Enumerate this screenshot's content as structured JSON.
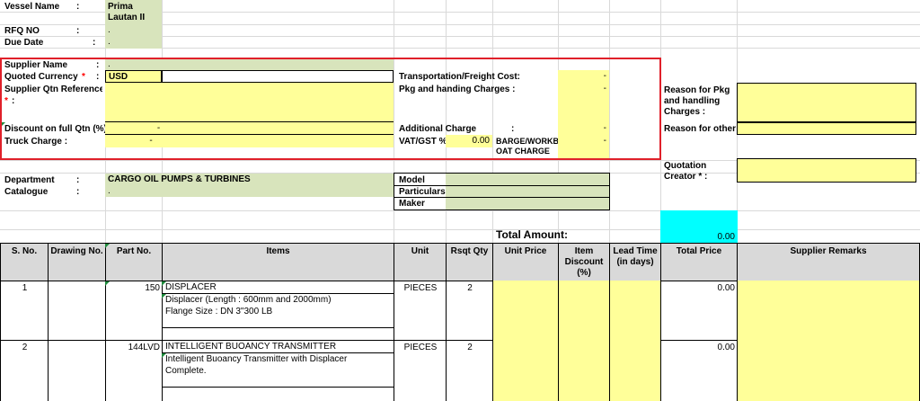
{
  "header": {
    "vessel_name_label": "Vessel Name",
    "vessel_name_colon": ":",
    "vessel_name_value_1": "Prima",
    "vessel_name_value_2": "Lautan II",
    "rfq_no_label": "RFQ NO",
    "rfq_no_colon": ":",
    "rfq_no_value": ".",
    "due_date_label": "Due Date",
    "due_date_colon": ":",
    "due_date_value": "."
  },
  "supplier": {
    "supplier_name_label": "Supplier Name",
    "supplier_name_colon": ":",
    "supplier_name_value": ".",
    "quoted_currency_label": "Quoted Currency",
    "quoted_currency_star": "*",
    "quoted_currency_colon": ":",
    "quoted_currency_value": "USD",
    "supplier_qtn_ref_label": "Supplier Qtn Reference",
    "supplier_qtn_ref_star": "*",
    "supplier_qtn_ref_colon": ":",
    "discount_label": "Discount on full Qtn  (%)",
    "discount_value": "-",
    "truck_charge_label": "Truck Charge :",
    "truck_charge_value": "-",
    "transport_label": "Transportation/Freight Cost:",
    "transport_value": "-",
    "pkg_label": "Pkg and handing Charges  :",
    "pkg_value": "-",
    "additional_label": "Additional Charge",
    "additional_colon": ":",
    "additional_value": "-",
    "vat_label": "VAT/GST %",
    "vat_value": "0.00",
    "barge_label_1": "BARGE/WORKB",
    "barge_label_2": "OAT CHARGE",
    "barge_value": "-"
  },
  "reasons": {
    "reason_pkg_1": "Reason for Pkg",
    "reason_pkg_2": "and handling",
    "reason_pkg_3": "Charges :",
    "reason_other": "Reason for other",
    "quotation_creator_1": "Quotation",
    "quotation_creator_2": "Creator * :"
  },
  "department": {
    "department_label": "Department",
    "department_colon": ":",
    "department_value": "CARGO OIL PUMPS & TURBINES",
    "catalogue_label": "Catalogue",
    "catalogue_colon": ":",
    "catalogue_value": ".",
    "model_label": "Model",
    "particulars_label": "Particulars",
    "maker_label": "Maker"
  },
  "totals": {
    "total_amount_label": "Total Amount:",
    "total_amount_value": "0.00"
  },
  "table": {
    "headers": {
      "sno": "S. No.",
      "drawing": "Drawing No.",
      "part": "Part No.",
      "items": "Items",
      "unit": "Unit",
      "rsqt": "Rsqt Qty",
      "unit_price": "Unit Price",
      "item_discount_1": "Item",
      "item_discount_2": "Discount",
      "item_discount_3": "(%)",
      "lead_time_1": "Lead Time",
      "lead_time_2": "(in days)",
      "total_price": "Total Price",
      "remarks": "Supplier Remarks"
    },
    "rows": [
      {
        "sno": "1",
        "part": "150",
        "item_title": "DISPLACER",
        "item_desc_1": "Displacer (Length : 600mm and 2000mm)",
        "item_desc_2": "Flange Size : DN 3\"300 LB",
        "unit": "PIECES",
        "qty": "2",
        "total": "0.00"
      },
      {
        "sno": "2",
        "part": "144LVD",
        "item_title": "INTELLIGENT BUOANCY TRANSMITTER",
        "item_desc_1": "Intelligent Buoancy Transmitter with Displacer",
        "item_desc_2": "Complete.",
        "unit": "PIECES",
        "qty": "2",
        "total": "0.00"
      }
    ]
  },
  "colors": {
    "input_yellow": "#ffff99",
    "readonly_green": "#d8e4bc",
    "total_cyan": "#00ffff",
    "highlight_red": "#e0202a",
    "header_gray": "#d9d9d9"
  }
}
